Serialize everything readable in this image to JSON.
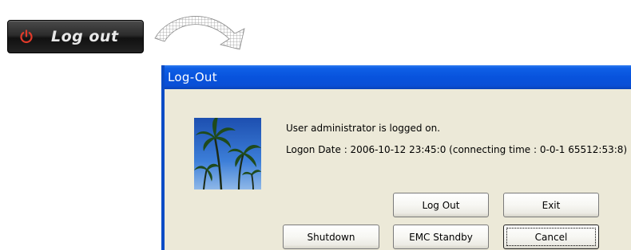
{
  "logout_button": {
    "label": "Log out",
    "icon": "power-icon",
    "icon_color": "#e03a2a"
  },
  "arrow": {
    "icon": "curved-arrow-icon"
  },
  "dialog": {
    "title": "Log-Out",
    "titlebar_color": "#0a55e0",
    "image": "palm-trees-icon",
    "user_line": "User  administrator  is logged on.",
    "logon_line": "Logon Date : 2006-10-12  23:45:0 (connecting time :  0-0-1  65512:53:8)",
    "buttons": {
      "log_out": "Log Out",
      "exit": "Exit",
      "shutdown": "Shutdown",
      "emc_standby": "EMC Standby",
      "cancel": "Cancel"
    }
  }
}
